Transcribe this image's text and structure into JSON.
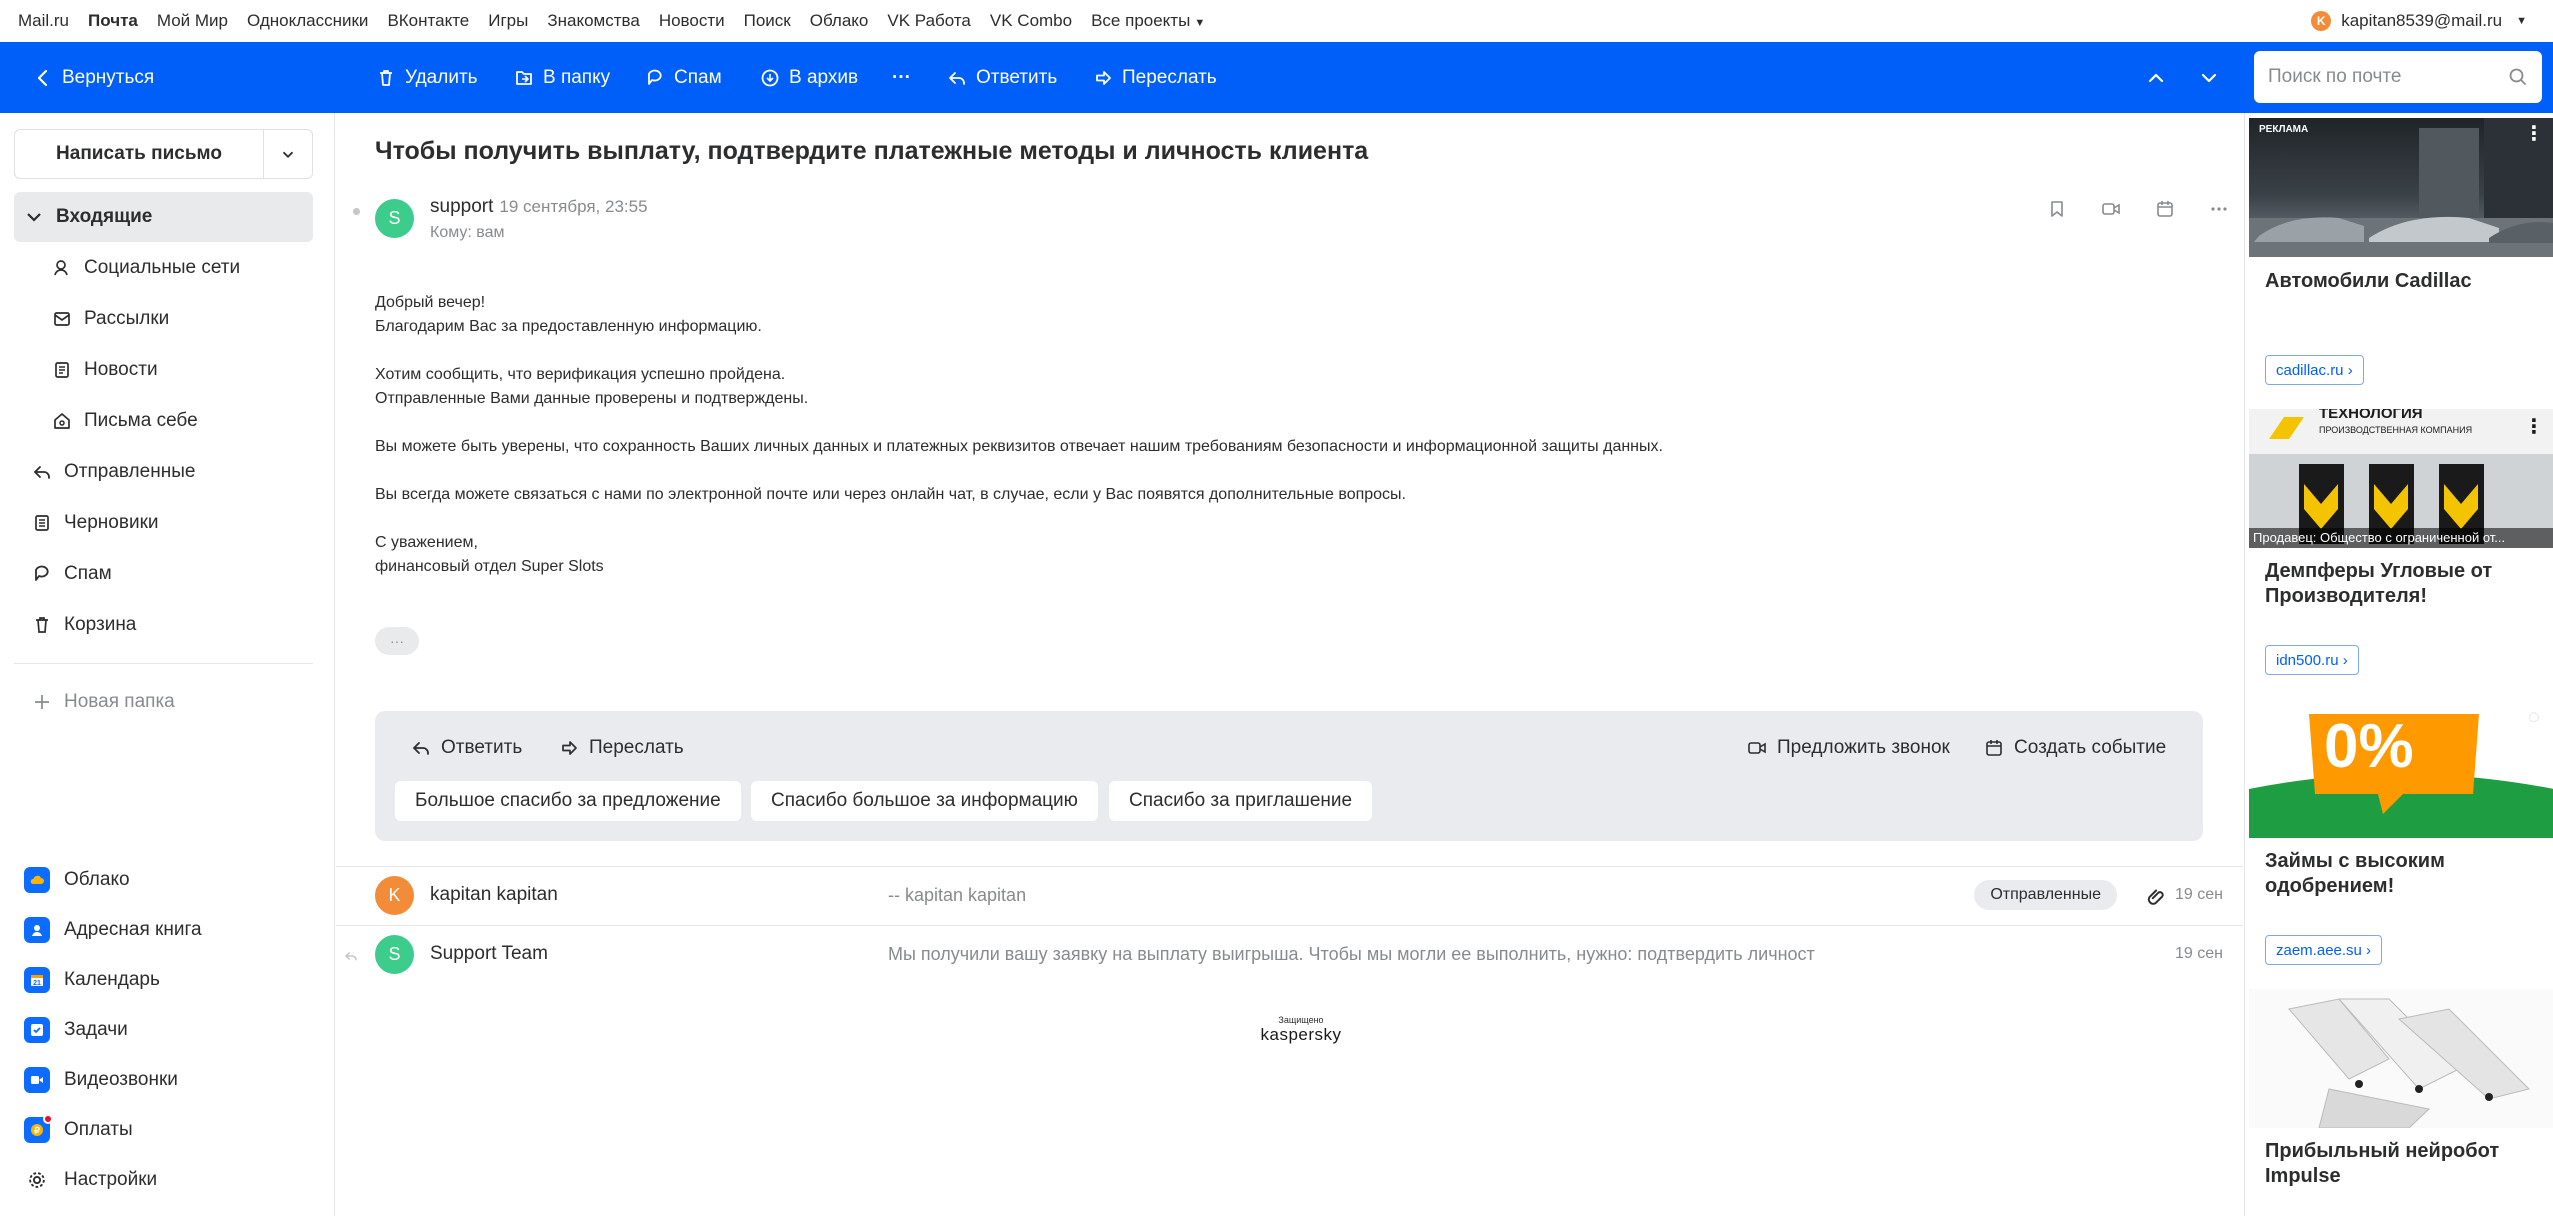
{
  "portal": {
    "links": [
      "Mail.ru",
      "Почта",
      "Мой Мир",
      "Одноклассники",
      "ВКонтакте",
      "Игры",
      "Знакомства",
      "Новости",
      "Поиск",
      "Облако",
      "VK Работа",
      "VK Combo",
      "Все проекты"
    ],
    "active_link": "Почта",
    "user_initial": "K",
    "user_email": "kapitan8539@mail.ru"
  },
  "toolbar": {
    "back": "Вернуться",
    "delete": "Удалить",
    "to_folder": "В папку",
    "spam": "Спам",
    "archive": "В архив",
    "more": "···",
    "reply": "Ответить",
    "forward": "Переслать",
    "search_placeholder": "Поиск по почте"
  },
  "sidebar": {
    "compose": "Написать письмо",
    "folders": [
      {
        "label": "Входящие",
        "icon": "chevron-down-icon"
      },
      {
        "label": "Социальные сети",
        "icon": "people-icon"
      },
      {
        "label": "Рассылки",
        "icon": "newsletter-icon"
      },
      {
        "label": "Новости",
        "icon": "news-icon"
      },
      {
        "label": "Письма себе",
        "icon": "self-mail-icon"
      },
      {
        "label": "Отправленные",
        "icon": "sent-icon"
      },
      {
        "label": "Черновики",
        "icon": "drafts-icon"
      },
      {
        "label": "Спам",
        "icon": "spam-icon"
      },
      {
        "label": "Корзина",
        "icon": "trash-icon"
      }
    ],
    "new_folder": "Новая папка",
    "services": [
      {
        "label": "Облако",
        "color": "#0b6cff"
      },
      {
        "label": "Адресная книга",
        "color": "#0b6cff"
      },
      {
        "label": "Календарь",
        "color": "#0b6cff"
      },
      {
        "label": "Задачи",
        "color": "#0b6cff"
      },
      {
        "label": "Видеозвонки",
        "color": "#0b6cff"
      },
      {
        "label": "Оплаты",
        "color": "#0b6cff"
      },
      {
        "label": "Настройки",
        "color": "#2c2d2e"
      }
    ]
  },
  "message": {
    "subject": "Чтобы получить выплату, подтвердите платежные методы и личность клиента",
    "sender_initial": "S",
    "sender": "support",
    "date": "19 сентября, 23:55",
    "to": "Кому: вам",
    "body": [
      [
        "Добрый вечер!",
        "Благодарим Вас за предоставленную информацию."
      ],
      [
        "Хотим сообщить, что верификация успешно пройдена.",
        "Отправленные Вами данные проверены и подтверждены."
      ],
      [
        "Вы можете быть уверены, что сохранность Ваших личных данных и платежных реквизитов отвечает нашим требованиям безопасности и информационной защиты данных."
      ],
      [
        "Вы всегда можете связаться с нами по электронной почте или через онлайн чат, в случае, если у Вас появятся дополнительные вопросы."
      ],
      [
        "С уважением,",
        "финансовый отдел Super Slots"
      ]
    ],
    "more": "···"
  },
  "reply_box": {
    "reply": "Ответить",
    "forward": "Переслать",
    "call": "Предложить звонок",
    "event": "Создать событие",
    "quick": [
      "Большое спасибо за предложение",
      "Спасибо большое за информацию",
      "Спасибо за приглашение"
    ]
  },
  "thread": [
    {
      "initial": "K",
      "name": "kapitan kapitan",
      "snippet": "-- kapitan kapitan",
      "badge": "Отправленные",
      "date": "19 сен",
      "color": "#f28c38"
    },
    {
      "initial": "S",
      "name": "Support Team",
      "snippet": "Мы получили вашу заявку на выплату выигрыша. Чтобы мы могли ее выполнить, нужно: подтвердить личност",
      "date": "19 сен",
      "color": "#3ccd8c"
    }
  ],
  "kaspersky": {
    "small": "Защищено",
    "brand": "kaspersky"
  },
  "ads": [
    {
      "label": "РЕКЛАМА",
      "title": "Автомобили Cadillac",
      "link": "cadillac.ru ›"
    },
    {
      "overlay_top": "ТЕХНОЛОГИЯ",
      "overlay_sub": "ПРОИЗВОДСТВЕННАЯ КОМПАНИЯ",
      "overlay_bottom": "Продавец: Общество с ограниченной от...",
      "title": "Демпферы Угловые от Производителя!",
      "link": "idn500.ru ›"
    },
    {
      "overlay_big": "0%",
      "title": "Займы с высоким одобрением!",
      "link": "zaem.aee.su ›"
    },
    {
      "title": "Прибыльный нейробот Impulse"
    }
  ]
}
